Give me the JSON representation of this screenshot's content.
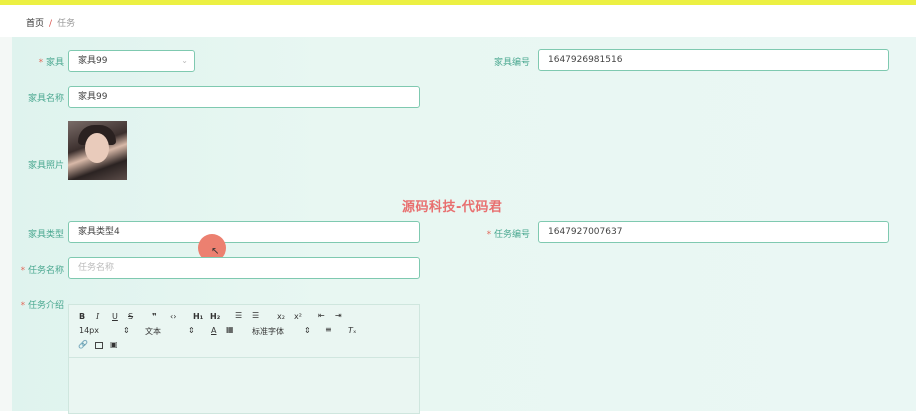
{
  "breadcrumb": {
    "home": "首页",
    "separator": "/",
    "current": "任务"
  },
  "form": {
    "furniture": {
      "label": "家具",
      "required": true,
      "value": "家具99"
    },
    "furniture_no": {
      "label": "家具编号",
      "value": "1647926981516"
    },
    "furniture_name": {
      "label": "家具名称",
      "value": "家具99"
    },
    "furniture_photo": {
      "label": "家具照片"
    },
    "furniture_type": {
      "label": "家具类型",
      "value": "家具类型4"
    },
    "task_no": {
      "label": "任务编号",
      "required": true,
      "value": "1647927007637"
    },
    "task_name": {
      "label": "任务名称",
      "required": true,
      "placeholder": "任务名称"
    },
    "task_intro": {
      "label": "任务介绍",
      "required": true
    }
  },
  "editor": {
    "font_size": "14px",
    "block_format": "文本",
    "font_family": "标准字体",
    "tools_row1": [
      "bold-icon",
      "italic-icon",
      "underline-icon",
      "strike-icon",
      "quote-icon",
      "code-icon",
      "h1-icon",
      "h2-icon",
      "ordered-list-icon",
      "bullet-list-icon",
      "subscript-icon",
      "superscript-icon",
      "outdent-icon",
      "indent-icon"
    ],
    "tools_row3": [
      "link-icon",
      "image-icon",
      "video-icon"
    ]
  },
  "watermark": "源码科技-代码君",
  "colors": {
    "accent": "#4aa890",
    "required": "#e26b5c",
    "topbar": "#ecf042",
    "border": "#7fc9b0"
  }
}
